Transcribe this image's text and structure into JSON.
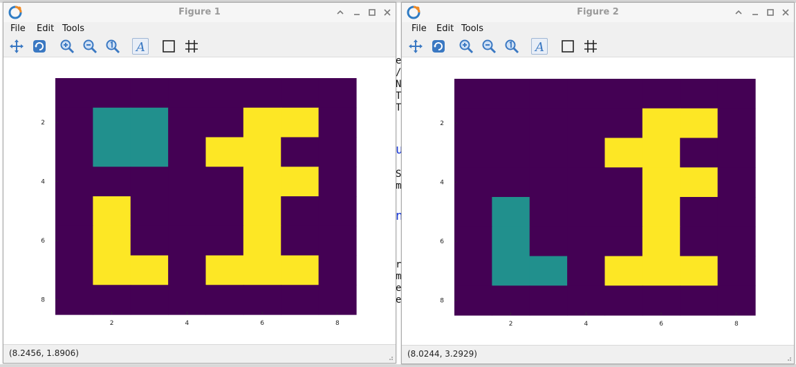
{
  "background_app": {
    "text_fragments": [
      "e",
      "/",
      "N",
      "T",
      "T",
      "u",
      "S",
      "m",
      "n",
      "r",
      "m",
      "e",
      "e"
    ]
  },
  "colors": {
    "dark": "#440154",
    "teal": "#21908d",
    "yellow": "#fde725",
    "title_text": "#9a9a9a"
  },
  "menu": {
    "file": "File",
    "edit": "Edit",
    "tools": "Tools"
  },
  "toolbar_icons": [
    "pan-icon",
    "rotate-icon",
    "zoom-in-icon",
    "zoom-out-icon",
    "zoom-original-icon",
    "text-annotation-icon",
    "axes-box-icon",
    "grid-icon"
  ],
  "windows": [
    {
      "title": "Figure 1",
      "status": "(8.2456, 1.8906)"
    },
    {
      "title": "Figure 2",
      "status": "(8.0244, 3.2929)"
    }
  ],
  "chart_data": [
    {
      "type": "heatmap",
      "title": "",
      "xlabel": "",
      "ylabel": "",
      "x_ticks": [
        2,
        4,
        6,
        8
      ],
      "y_ticks": [
        2,
        4,
        6,
        8
      ],
      "color_scale": [
        "#440154",
        "#21908d",
        "#fde725"
      ],
      "rows": [
        [
          0,
          0,
          0,
          0,
          0,
          0,
          0,
          0
        ],
        [
          0,
          1,
          1,
          0,
          0,
          2,
          2,
          0
        ],
        [
          0,
          1,
          1,
          0,
          2,
          2,
          0,
          0
        ],
        [
          0,
          0,
          0,
          0,
          0,
          2,
          2,
          0
        ],
        [
          0,
          2,
          0,
          0,
          0,
          2,
          0,
          0
        ],
        [
          0,
          2,
          0,
          0,
          0,
          2,
          0,
          0
        ],
        [
          0,
          2,
          2,
          0,
          2,
          2,
          2,
          0
        ],
        [
          0,
          0,
          0,
          0,
          0,
          0,
          0,
          0
        ]
      ]
    },
    {
      "type": "heatmap",
      "title": "",
      "xlabel": "",
      "ylabel": "",
      "x_ticks": [
        2,
        4,
        6,
        8
      ],
      "y_ticks": [
        2,
        4,
        6,
        8
      ],
      "color_scale": [
        "#440154",
        "#21908d",
        "#fde725"
      ],
      "rows": [
        [
          0,
          0,
          0,
          0,
          0,
          0,
          0,
          0
        ],
        [
          0,
          0,
          0,
          0,
          0,
          2,
          2,
          0
        ],
        [
          0,
          0,
          0,
          0,
          2,
          2,
          0,
          0
        ],
        [
          0,
          0,
          0,
          0,
          0,
          2,
          2,
          0
        ],
        [
          0,
          1,
          0,
          0,
          0,
          2,
          0,
          0
        ],
        [
          0,
          1,
          0,
          0,
          0,
          2,
          0,
          0
        ],
        [
          0,
          1,
          1,
          0,
          2,
          2,
          2,
          0
        ],
        [
          0,
          0,
          0,
          0,
          0,
          0,
          0,
          0
        ]
      ]
    }
  ]
}
